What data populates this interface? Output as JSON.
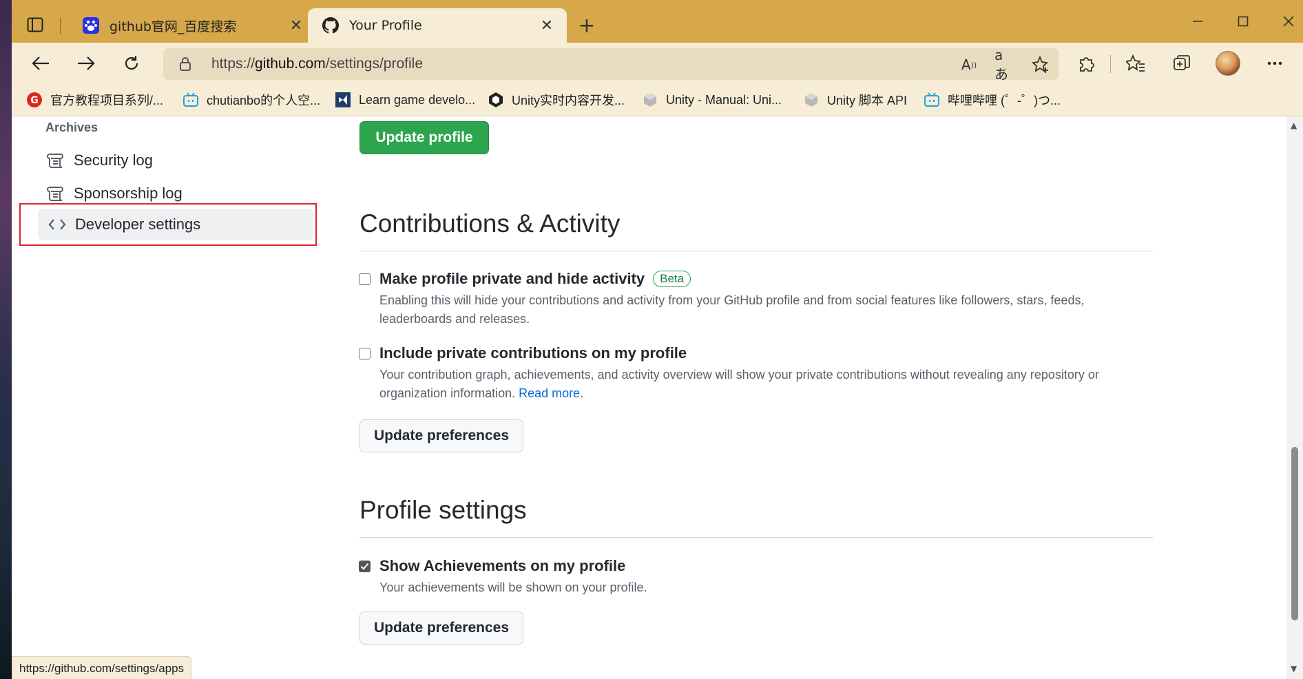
{
  "browser": {
    "tabs": [
      {
        "title": "github官网_百度搜索",
        "favicon": "baidu-paw-icon",
        "active": false
      },
      {
        "title": "Your Profile",
        "favicon": "github-octocat-icon",
        "active": true
      }
    ],
    "address": {
      "prefix": "https://",
      "host": "github.com",
      "path": "/settings/profile"
    },
    "bookmarks": [
      {
        "label": "官方教程项目系列/...",
        "icon": "g-logo-icon"
      },
      {
        "label": "chutianbo的个人空...",
        "icon": "bilibili-tv-icon"
      },
      {
        "label": "Learn game develo...",
        "icon": "vs-logo-icon"
      },
      {
        "label": "Unity实时内容开发...",
        "icon": "unity-logo-icon"
      },
      {
        "label": "Unity - Manual: Uni...",
        "icon": "unity-cube-icon"
      },
      {
        "label": "Unity 脚本 API",
        "icon": "unity-cube-icon"
      },
      {
        "label": "哔哩哔哩 (゜-゜)つ...",
        "icon": "bilibili-tv-icon"
      }
    ],
    "status_url": "https://github.com/settings/apps"
  },
  "sidebar": {
    "heading": "Archives",
    "items": [
      {
        "label": "Security log",
        "icon": "log-icon"
      },
      {
        "label": "Sponsorship log",
        "icon": "log-icon"
      },
      {
        "label": "Developer settings",
        "icon": "code-icon",
        "selected": true
      }
    ]
  },
  "main": {
    "update_profile_label": "Update profile",
    "contributions": {
      "title": "Contributions & Activity",
      "options": [
        {
          "label": "Make profile private and hide activity",
          "badge": "Beta",
          "checked": false,
          "description": "Enabling this will hide your contributions and activity from your GitHub profile and from social features like followers, stars, feeds, leaderboards and releases."
        },
        {
          "label": "Include private contributions on my profile",
          "checked": false,
          "description": "Your contribution graph, achievements, and activity overview will show your private contributions without revealing any repository or organization information.",
          "link_text": "Read more",
          "trailing": "."
        }
      ],
      "button_label": "Update preferences"
    },
    "profile_settings": {
      "title": "Profile settings",
      "options": [
        {
          "label": "Show Achievements on my profile",
          "checked": true,
          "description": "Your achievements will be shown on your profile."
        }
      ],
      "button_label": "Update preferences"
    }
  },
  "colors": {
    "tabbar": "#d6a84a",
    "toolbar": "#f7edd6",
    "primary_button": "#2da44e",
    "highlight": "#e02424",
    "link": "#0969da"
  }
}
